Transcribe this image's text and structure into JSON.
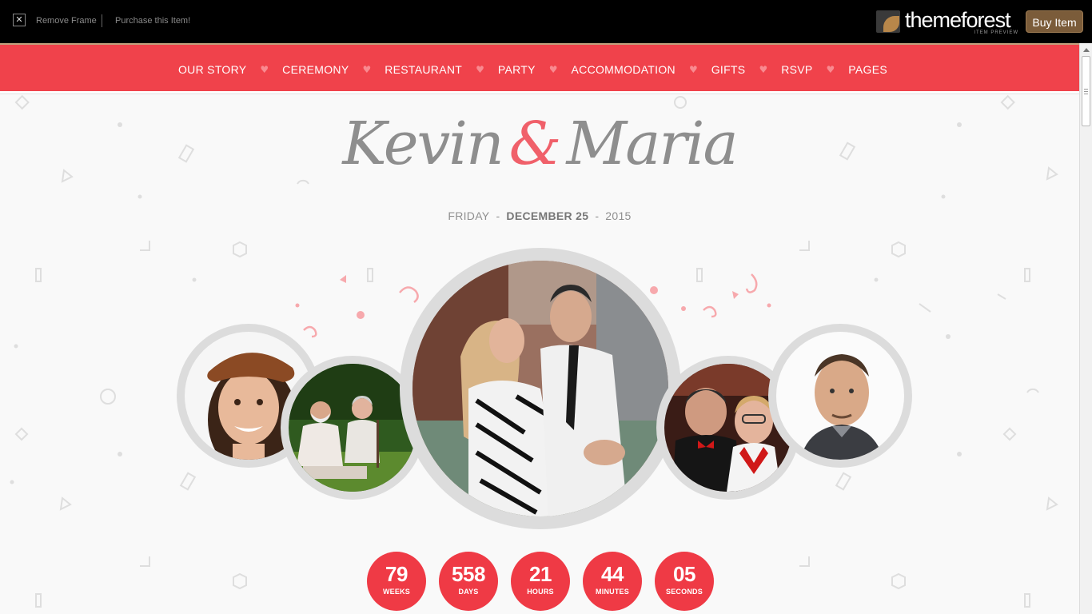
{
  "topbar": {
    "remove_frame": "Remove Frame",
    "purchase": "Purchase this Item!",
    "logo_word": "themeforest",
    "logo_sub": "ITEM PREVIEW",
    "buy_button": "Buy Item"
  },
  "nav": {
    "items": [
      "OUR STORY",
      "CEREMONY",
      "RESTAURANT",
      "PARTY",
      "ACCOMMODATION",
      "GIFTS",
      "RSVP",
      "PAGES"
    ],
    "separator_icon": "heart-icon",
    "bg_color": "#f0424b"
  },
  "hero": {
    "name_1": "Kevin",
    "ampersand": "&",
    "name_2": "Maria",
    "day": "FRIDAY",
    "date": "DECEMBER 25",
    "year": "2015",
    "accent_color": "#f0606a"
  },
  "countdown": [
    {
      "value": "79",
      "label": "WEEKS"
    },
    {
      "value": "558",
      "label": "DAYS"
    },
    {
      "value": "21",
      "label": "HOURS"
    },
    {
      "value": "44",
      "label": "MINUTES"
    },
    {
      "value": "05",
      "label": "SECONDS"
    }
  ]
}
